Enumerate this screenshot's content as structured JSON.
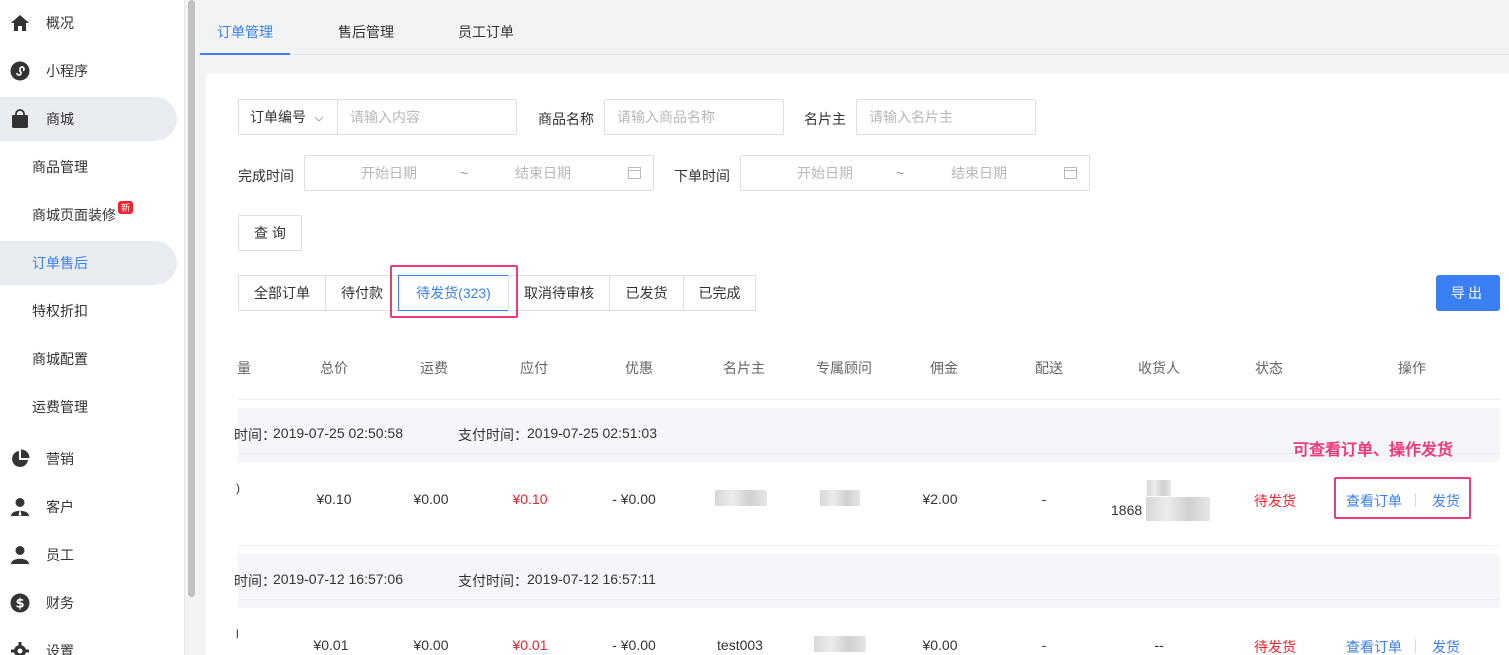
{
  "sidebar": {
    "items": [
      {
        "label": "概况",
        "icon": "home-icon"
      },
      {
        "label": "小程序",
        "icon": "miniprogram-icon"
      },
      {
        "label": "商城",
        "icon": "shopping-bag-icon"
      },
      {
        "label": "营销",
        "icon": "pie-chart-icon"
      },
      {
        "label": "客户",
        "icon": "customer-icon"
      },
      {
        "label": "员工",
        "icon": "user-icon"
      },
      {
        "label": "财务",
        "icon": "dollar-icon"
      },
      {
        "label": "设置",
        "icon": "gear-icon"
      }
    ],
    "sub_items": [
      {
        "label": "商品管理"
      },
      {
        "label": "商城页面装修",
        "badge": "新"
      },
      {
        "label": "订单售后"
      },
      {
        "label": "特权折扣"
      },
      {
        "label": "商城配置"
      },
      {
        "label": "运费管理"
      }
    ]
  },
  "top_tabs": [
    "订单管理",
    "售后管理",
    "员工订单"
  ],
  "filters": {
    "order_no_select": "订单编号",
    "content_placeholder": "请输入内容",
    "product_label": "商品名称",
    "product_placeholder": "请输入商品名称",
    "card_owner_label": "名片主",
    "card_owner_placeholder": "请输入名片主",
    "complete_time_label": "完成时间",
    "order_time_label": "下单时间",
    "start_placeholder": "开始日期",
    "end_placeholder": "结束日期",
    "range_sep": "~",
    "query_button": "查 询"
  },
  "status_tabs": [
    "全部订单",
    "待付款",
    "待发货(323)",
    "取消待审核",
    "已发货",
    "已完成"
  ],
  "export_button": "导出",
  "annotation": "可查看订单、操作发货",
  "table": {
    "headers": [
      "量",
      "总价",
      "运费",
      "应付",
      "优惠",
      "名片主",
      "专属顾问",
      "佣金",
      "配送",
      "收货人",
      "状态",
      "操作"
    ],
    "orders": [
      {
        "order_time_label": "时间：",
        "order_time": "2019-07-25 02:50:58",
        "pay_time_label": "支付时间：",
        "pay_time": "2019-07-25 02:51:03",
        "qty": ")",
        "total": "¥0.10",
        "freight": "¥0.00",
        "payable": "¥0.10",
        "discount": "- ¥0.00",
        "card_owner": "",
        "advisor": "",
        "commission": "¥2.00",
        "delivery": "-",
        "receiver_top": "",
        "receiver": "1868",
        "status": "待发货",
        "view_link": "查看订单",
        "ship_link": "发货"
      },
      {
        "order_time_label": "时间：",
        "order_time": "2019-07-12 16:57:06",
        "pay_time_label": "支付时间：",
        "pay_time": "2019-07-12 16:57:11",
        "qty": "l",
        "total": "¥0.01",
        "freight": "¥0.00",
        "payable": "¥0.01",
        "discount": "- ¥0.00",
        "card_owner": "test003",
        "advisor": "",
        "commission": "¥0.00",
        "delivery": "-",
        "receiver": "--",
        "status": "待发货",
        "view_link": "查看订单",
        "ship_link": "发货"
      }
    ]
  }
}
